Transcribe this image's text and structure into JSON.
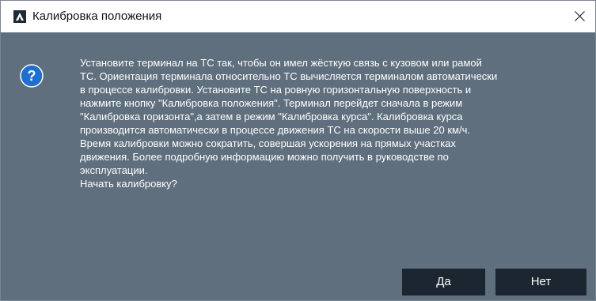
{
  "window": {
    "title": "Калибровка положения",
    "close_glyph": "×",
    "icon": "app-logo-icon"
  },
  "dialog": {
    "icon": "question-icon",
    "message_lines": [
      "Установите терминал на ТС так, чтобы он имел жёсткую связь с кузовом или рамой",
      "ТС. Ориентация терминала относительно ТС вычисляется терминалом автоматически",
      "в процессе калибровки. Установите ТС на ровную горизонтальную поверхность и",
      "нажмите кнопку \"Калибровка положения\". Терминал перейдет сначала в режим",
      "\"Калибровка горизонта\",а затем в режим \"Калибровка курса\". Калибровка курса",
      "производится автоматически в процессе движения ТС на скорости выше 20 км/ч.",
      "Время калибровки можно сократить, совершая ускорения на прямых участках",
      "движения. Более подробную информацию можно получить в руководстве по",
      "эксплуатации.",
      "Начать калибровку?"
    ],
    "yes_label": "Да",
    "no_label": "Нет"
  },
  "colors": {
    "body_bg": "#5f6f7d",
    "button_bg": "#1c2630",
    "question_icon": "#1e6fd0"
  }
}
